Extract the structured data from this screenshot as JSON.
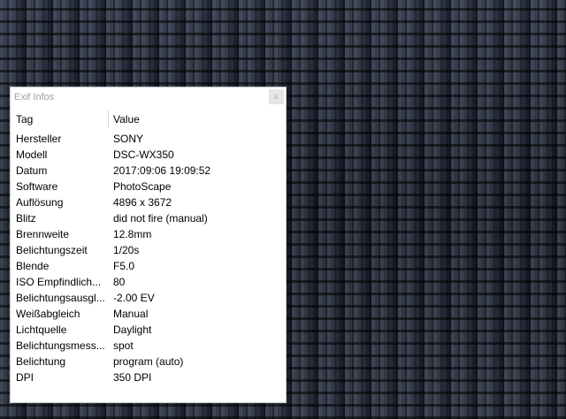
{
  "window": {
    "title": "Exif Infos",
    "close_label": "x"
  },
  "table": {
    "headers": {
      "tag": "Tag",
      "value": "Value"
    },
    "rows": [
      {
        "tag": "Hersteller",
        "value": "SONY"
      },
      {
        "tag": "Modell",
        "value": "DSC-WX350"
      },
      {
        "tag": "Datum",
        "value": "2017:09:06 19:09:52"
      },
      {
        "tag": "Software",
        "value": "PhotoScape"
      },
      {
        "tag": "Auflösung",
        "value": "4896 x 3672"
      },
      {
        "tag": "Blitz",
        "value": "did not fire (manual)"
      },
      {
        "tag": "Brennweite",
        "value": "12.8mm"
      },
      {
        "tag": "Belichtungszeit",
        "value": "1/20s"
      },
      {
        "tag": "Blende",
        "value": "F5.0"
      },
      {
        "tag": "ISO Empfindlich...",
        "value": "80"
      },
      {
        "tag": "Belichtungsausgl...",
        "value": "-2.00 EV"
      },
      {
        "tag": "Weißabgleich",
        "value": "Manual"
      },
      {
        "tag": "Lichtquelle",
        "value": "Daylight"
      },
      {
        "tag": "Belichtungsmess...",
        "value": "spot"
      },
      {
        "tag": "Belichtung",
        "value": "program (auto)"
      },
      {
        "tag": "DPI",
        "value": "350 DPI"
      }
    ]
  }
}
